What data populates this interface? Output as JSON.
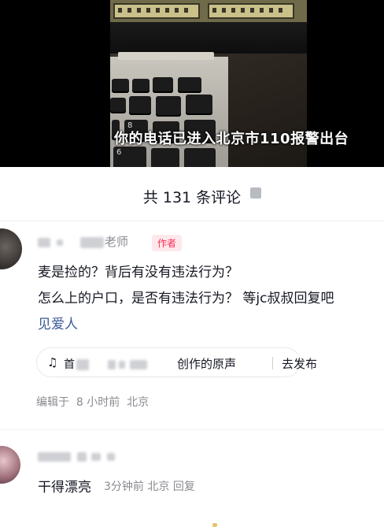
{
  "video": {
    "caption": "你的电话已进入北京市110报警出台",
    "keys": [
      "8",
      "6"
    ]
  },
  "comments_panel": {
    "count_title": "共 131 条评论"
  },
  "comment1": {
    "username": "老师",
    "author_badge": "作者",
    "lines": [
      "麦是捡的？背后有没有违法行为？",
      "怎么上的户口，是否有违法行为？ 等jc叔叔回复吧",
      "见爱人"
    ],
    "music": {
      "owner": "首",
      "name_suffix": "创作的原声",
      "action": "去发布"
    },
    "meta": {
      "edited_label": "编辑于",
      "time": "8 小时前",
      "location": "北京"
    }
  },
  "comment2": {
    "text": "干得漂亮",
    "time": "3分钟前",
    "location": "北京",
    "reply_label": "回复"
  },
  "colors": {
    "accent_red": "#fe2c55",
    "mention_blue": "#3a5a96",
    "meta_gray": "#8a8b91"
  }
}
